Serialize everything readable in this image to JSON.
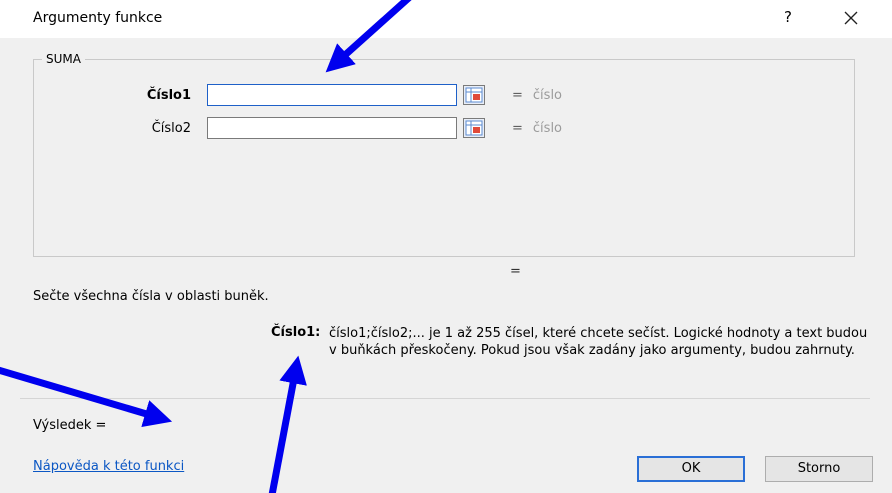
{
  "window": {
    "title": "Argumenty funkce",
    "help_label": "?"
  },
  "group": {
    "label": "SUMA"
  },
  "arguments": [
    {
      "label": "Číslo1",
      "value": "",
      "result_prefix": "=",
      "result_value": "číslo"
    },
    {
      "label": "Číslo2",
      "value": "",
      "result_prefix": "=",
      "result_value": "číslo"
    }
  ],
  "formula_result_eq": "=",
  "description": "Sečte všechna čísla v oblasti buněk.",
  "argument_help": {
    "label": "Číslo1:",
    "text": "číslo1;číslo2;... je 1 až 255 čísel, které chcete sečíst. Logické hodnoty a text budou v buňkách přeskočeny. Pokud jsou však zadány jako argumenty, budou zahrnuty."
  },
  "result_label": "Výsledek =",
  "help_link": "Nápověda k této funkci",
  "buttons": {
    "ok": "OK",
    "cancel": "Storno"
  },
  "colors": {
    "annotation_arrow": "#0000ee",
    "accent": "#2a6fd6"
  },
  "icons": {
    "close": "close-icon",
    "range_picker": "collapse-range-icon"
  }
}
